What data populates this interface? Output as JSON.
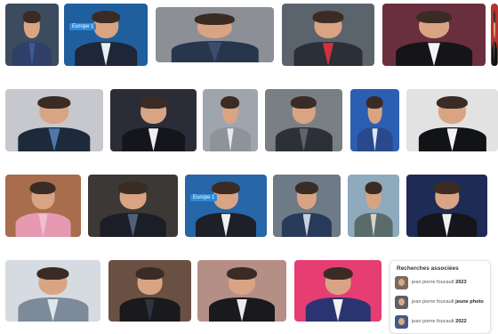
{
  "related_searches": {
    "title": "Recherches associées",
    "items": [
      {
        "query": "jean pierre foucault",
        "suffix": "2023"
      },
      {
        "query": "jean pierre foucault",
        "suffix": "jeune photo"
      },
      {
        "query": "jean pierre foucault",
        "suffix": "2022"
      }
    ]
  },
  "watermark_text": "Europe 1",
  "image_results": [
    {
      "name": "result-1",
      "bg": "#3c4c5e",
      "suit": "#2f3f67",
      "shirt": "#3b5b9a"
    },
    {
      "name": "result-2",
      "bg": "#1f5f9e",
      "suit": "#1e2638",
      "shirt": "#e9eef4"
    },
    {
      "name": "result-3",
      "bg": "#8c8f96",
      "suit": "#27364d",
      "shirt": "#3c4c6e"
    },
    {
      "name": "result-4",
      "bg": "#5b636d",
      "suit": "#2a2f38",
      "shirt": "#d2313c"
    },
    {
      "name": "result-5",
      "bg": "#6a2f3f",
      "suit": "#141419",
      "shirt": "#f4f4f4"
    },
    {
      "name": "result-6",
      "bg": "#b5342d",
      "suit": "#111114",
      "shirt": "#f2f2f2"
    },
    {
      "name": "result-7",
      "bg": "#c7c8cd",
      "suit": "#1c2a3c",
      "shirt": "#4e78a8"
    },
    {
      "name": "result-8",
      "bg": "#2a2d37",
      "suit": "#15161b",
      "shirt": "#f0f0f0"
    },
    {
      "name": "result-9",
      "bg": "#9fa5ad",
      "suit": "#8e9299",
      "shirt": "#e8e9ec"
    },
    {
      "name": "result-10",
      "bg": "#7a7f84",
      "suit": "#2d3037",
      "shirt": "#5e636d"
    },
    {
      "name": "result-11",
      "bg": "#2a5fb3",
      "suit": "#29498c",
      "shirt": "#dde6f4"
    },
    {
      "name": "result-12",
      "bg": "#e2e2e2",
      "suit": "#121317",
      "shirt": "#f5f5f5"
    },
    {
      "name": "result-13",
      "bg": "#a86d4c",
      "suit": "#e59ab1",
      "shirt": "#efc0cf"
    },
    {
      "name": "result-14",
      "bg": "#3b3835",
      "suit": "#1b1e27",
      "shirt": "#51607a"
    },
    {
      "name": "result-15",
      "bg": "#2766a7",
      "suit": "#1d1f29",
      "shirt": "#f0f0f0"
    },
    {
      "name": "result-16",
      "bg": "#6e7a86",
      "suit": "#283a5a",
      "shirt": "#c7d0dc"
    },
    {
      "name": "result-17",
      "bg": "#8fa9bd",
      "suit": "#5a6c6a",
      "shirt": "#d9d3c7"
    },
    {
      "name": "result-18",
      "bg": "#1d2b55",
      "suit": "#15161b",
      "shirt": "#f0f0f0"
    },
    {
      "name": "result-19",
      "bg": "#d6dbe1",
      "suit": "#7d8a99",
      "shirt": "#dfe5ec"
    },
    {
      "name": "result-20",
      "bg": "#6a5043",
      "suit": "#1a1a1d",
      "shirt": "#2f3340"
    },
    {
      "name": "result-21",
      "bg": "#b58f86",
      "suit": "#1a1a1e",
      "shirt": "#ececec"
    },
    {
      "name": "result-22",
      "bg": "#e63d73",
      "suit": "#2a3470",
      "shirt": "#f2f2f2"
    }
  ]
}
